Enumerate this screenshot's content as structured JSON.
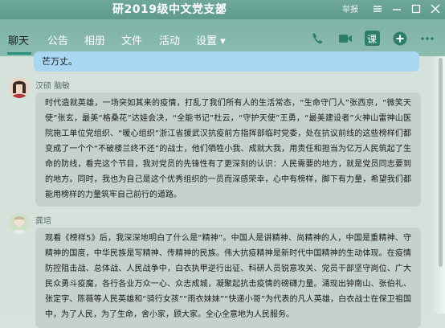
{
  "window": {
    "title": "研2019级中文党支部",
    "report_label": "举报"
  },
  "tabs": [
    {
      "label": "聊天"
    },
    {
      "label": "公告"
    },
    {
      "label": "相册"
    },
    {
      "label": "文件"
    },
    {
      "label": "活动"
    },
    {
      "label": "设置 ▾"
    }
  ],
  "toolbar": {
    "icons": [
      "phone-icon",
      "video-icon",
      "classroom-icon",
      "add-icon",
      "more-icon"
    ],
    "classroom_label": "课"
  },
  "messages": [
    {
      "text": "芒万丈。"
    },
    {
      "sender": "汉硕  脑敏",
      "text": "时代造就英雄，一场突如其来的疫情，打乱了我们所有人的生活常态，“生命守门人”张西京，“微笑天使”张玄，最美“格桑花”达娃会决，“全能书记”杜云，“守护天使”王勇，“最美建设者”火神山雷神山医院施工单位党组织、“暖心组织”浙江省援武汉抗疫前方指挥部临时党委，处在抗议前线的这些榜样们都变成了一个个“不破楼兰终不还”的战士，他们牺牲小我、成就大我，用责任和担当为亿万人民筑起了生命的防线，看完这个节目，我对党员的先锋性有了更深刻的认识：人民需要的地方，就是党员同志要到的地方。同时，我也为自己是这个优秀组织的一员而深感荣幸，心中有榜样，脚下有力量，希望我们都能用榜样的力量筑牢自己前行的道路。"
    },
    {
      "sender": "龚培",
      "text": "观看《榜样5》后，我深深地明白了什么是“精神”。中国人是讲精神、尚精神的人，中国是重精神、守精神的国度，中华民族是写精神、传精神的民族。伟大抗疫精神是新时代中国精神的生动体现。在疫情防控阻击战、总体战、人民战争中，白衣执甲逆行出征、科研人员锐意攻关、党员干部坚守岗位、广大民众勇斗疫魔，各行各业万众一心、众志成城，凝聚起抗击疫情的磅礴力量。涌现出钟南山、张伯礼、张定宇、陈薇等人民英雄和“骑行女孩”“雨衣妹妹”“快递小哥”为代表的凡人英雄，白衣战士在保卫祖国中，为了人民，为了生命，舍小家，顾大家。全心全意地为人民服务。"
    }
  ]
}
